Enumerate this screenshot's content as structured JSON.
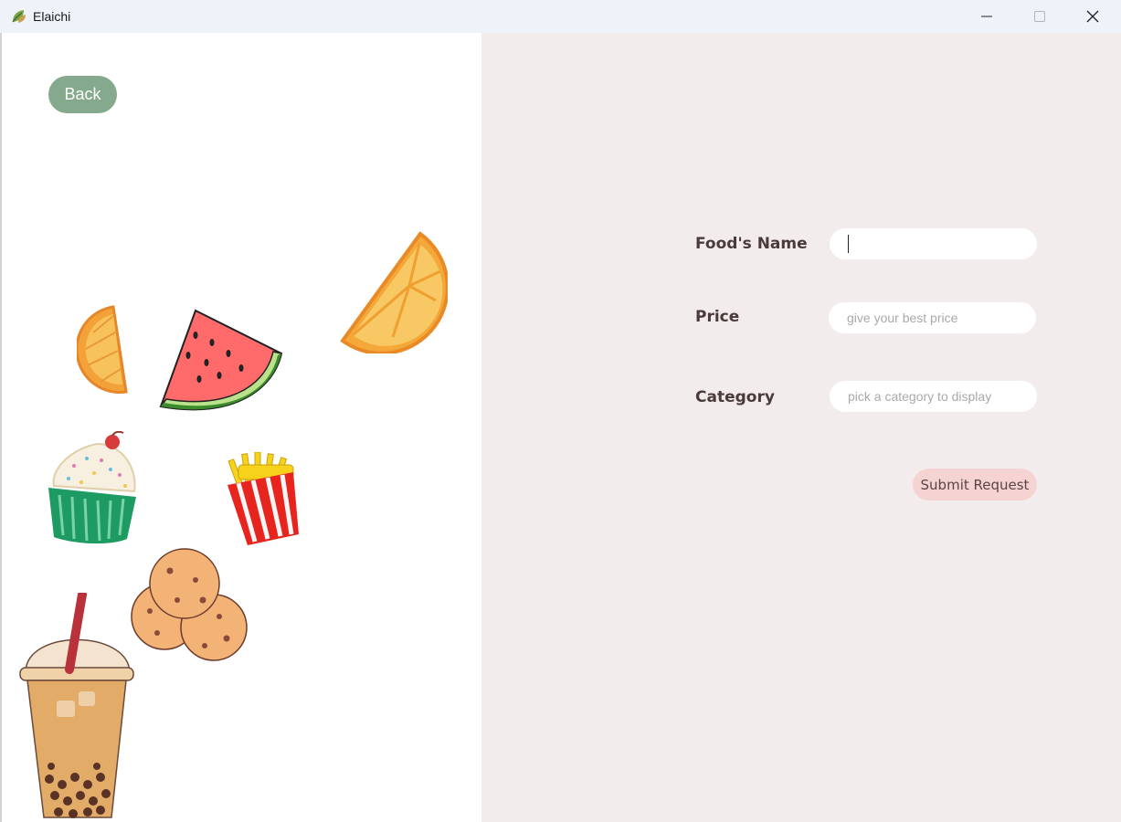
{
  "window": {
    "title": "Elaichi"
  },
  "nav": {
    "back_label": "Back"
  },
  "form": {
    "name_label": "Food's Name",
    "name_value": "",
    "price_label": "Price",
    "price_placeholder": "give your best price",
    "category_label": "Category",
    "category_placeholder": "pick a category to display",
    "submit_label": "Submit Request"
  },
  "colors": {
    "back_button": "#85a98c",
    "right_panel": "#f3ecec",
    "submit_button": "#f6d3d3",
    "label_text": "#4a3a3a"
  },
  "icons": [
    "leaf-icon",
    "minimize-icon",
    "maximize-icon",
    "close-icon"
  ],
  "illustrations": [
    "orange-slice",
    "watermelon-slice",
    "orange-wedge",
    "cupcake",
    "french-fries",
    "cookies",
    "boba-tea"
  ]
}
